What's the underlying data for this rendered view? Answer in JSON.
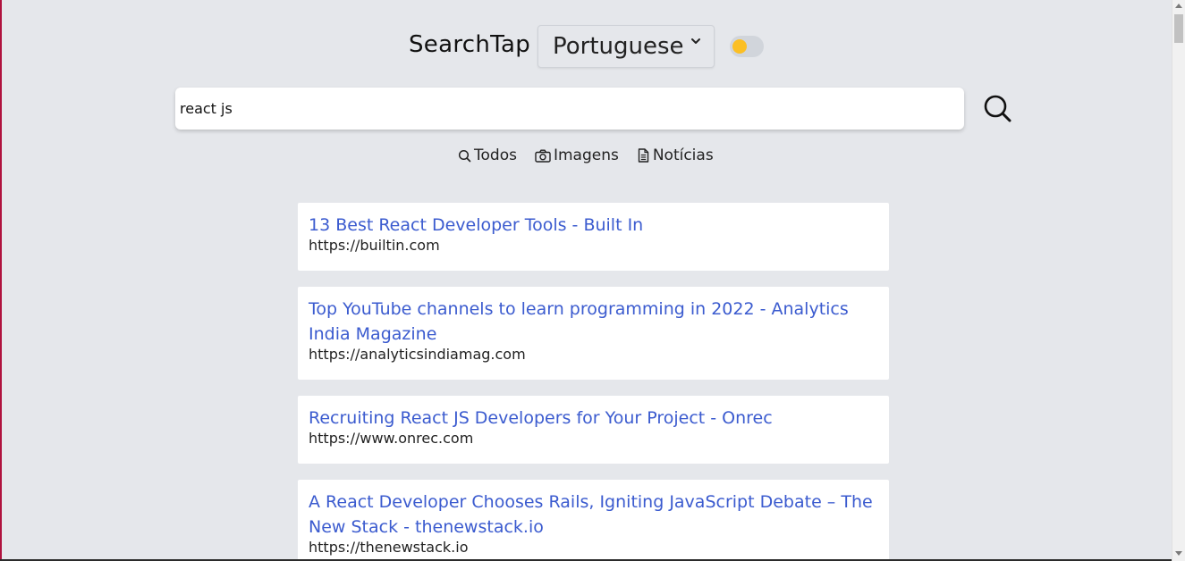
{
  "header": {
    "brand": "SearchTap",
    "language": "Portuguese",
    "theme_toggle_on": false,
    "toggle_knob_color": "#fbbf24"
  },
  "search": {
    "query": "react js",
    "icon": "search-icon"
  },
  "tabs": [
    {
      "label": "Todos",
      "icon": "search-icon"
    },
    {
      "label": "Imagens",
      "icon": "camera-icon"
    },
    {
      "label": "Notícias",
      "icon": "document-icon"
    }
  ],
  "results": [
    {
      "title": "13 Best React Developer Tools - Built In",
      "url": "https://builtin.com"
    },
    {
      "title": "Top YouTube channels to learn programming in 2022 - Analytics India Magazine",
      "url": "https://analyticsindiamag.com"
    },
    {
      "title": "Recruiting React JS Developers for Your Project - Onrec",
      "url": "https://www.onrec.com"
    },
    {
      "title": "A React Developer Chooses Rails, Igniting JavaScript Debate – The New Stack - thenewstack.io",
      "url": "https://thenewstack.io"
    }
  ],
  "colors": {
    "background": "#e5e7eb",
    "link": "#3b5bcf",
    "card": "#ffffff"
  }
}
